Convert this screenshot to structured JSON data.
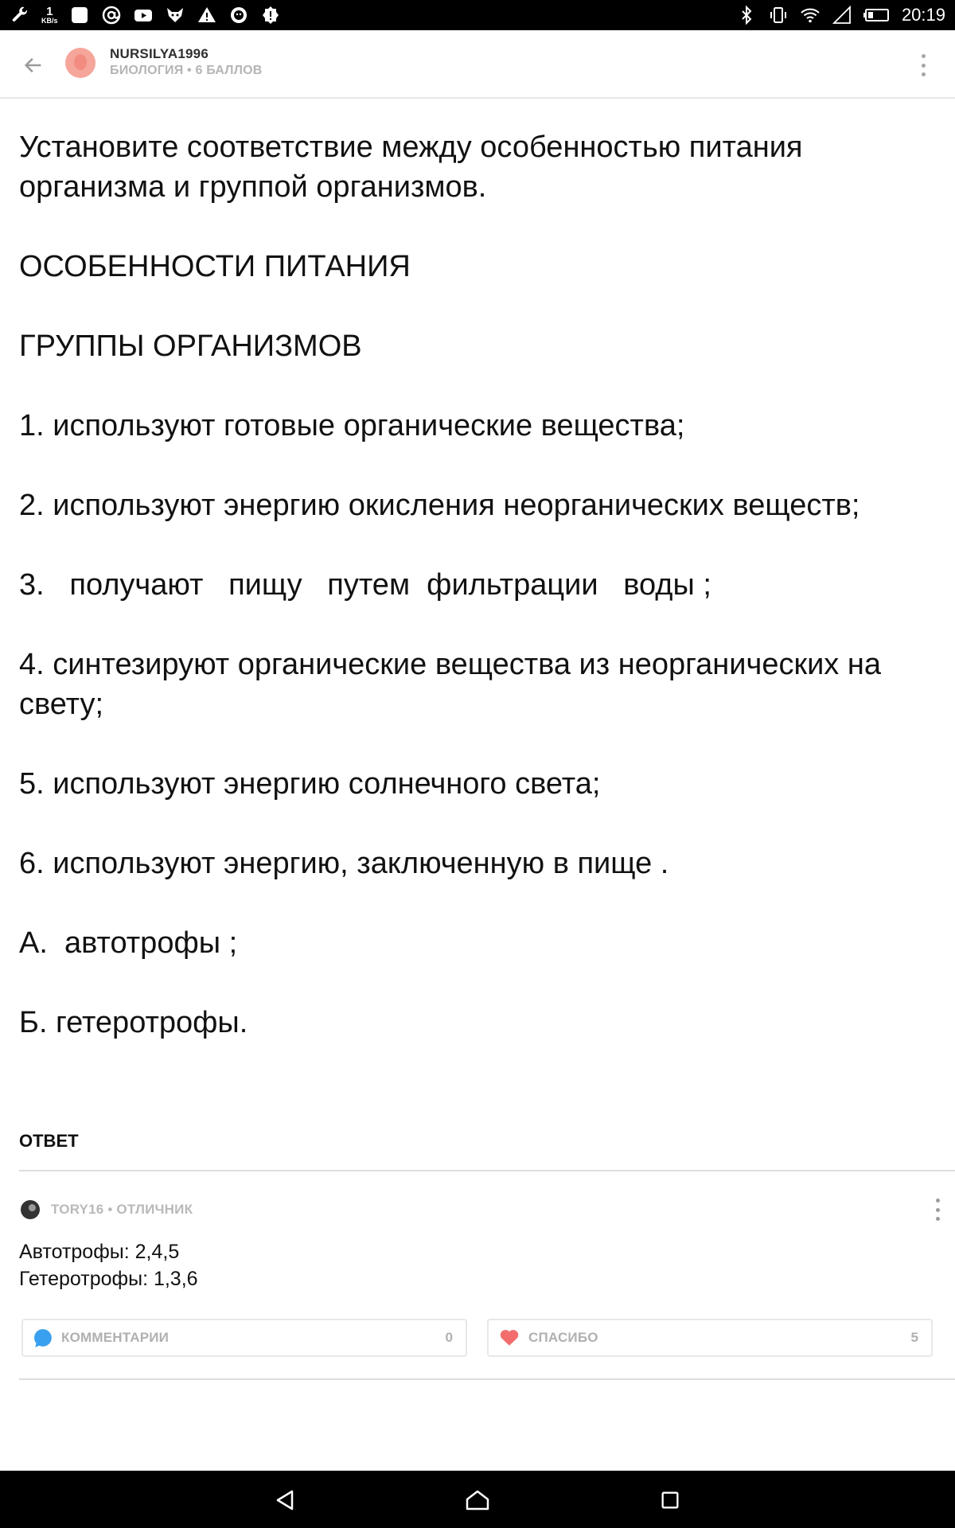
{
  "status_bar": {
    "net_speed_value": "1",
    "net_speed_unit": "KB/s",
    "time": "20:19",
    "left_icons": [
      "wrench-icon",
      "net-speed",
      "notes-icon",
      "at-icon",
      "youtube-icon",
      "fox-icon",
      "warning-icon",
      "lion-icon",
      "alert-icon"
    ],
    "right_icons": [
      "bluetooth-icon",
      "vibrate-icon",
      "wifi-icon",
      "signal-icon",
      "battery-icon"
    ]
  },
  "header": {
    "username": "NURSILYA1996",
    "meta": "БИОЛОГИЯ • 6 БАЛЛОВ",
    "back_icon": "arrow-left-icon",
    "menu_icon": "more-vert-icon"
  },
  "question": {
    "paragraphs": [
      "Установите соответствие между особенностью питания организма и группой организмов.",
      "ОСОБЕННОСТИ ПИТАНИЯ",
      "ГРУППЫ ОРГАНИЗМОВ",
      "1. используют готовые органические вещества;",
      "2. используют энергию окисления неорганических веществ;",
      "3.   получают   пищу   путем  фильтрации   воды ;",
      "4. синтезируют органические вещества из неорганических на свету;",
      "5. используют энергию солнечного света;",
      "6. используют энергию, заключенную в пище .",
      "А.  автотрофы ;",
      "Б. гетеротрофы."
    ]
  },
  "answer": {
    "section_title": "ОТВЕТ",
    "author": "TORY16 • ОТЛИЧНИК",
    "lines": [
      "Автотрофы: 2,4,5",
      "Гетеротрофы: 1,3,6"
    ],
    "comments_label": "КОММЕНТАРИИ",
    "comments_count": "0",
    "thanks_label": "СПАСИБО",
    "thanks_count": "5"
  },
  "colors": {
    "comment_icon": "#39a0ef",
    "heart_icon": "#f36d6d",
    "avatar": "#f6a59a",
    "muted_text": "#b5b5b5"
  },
  "nav_bar": [
    "back-triangle-icon",
    "home-icon",
    "recents-icon"
  ]
}
